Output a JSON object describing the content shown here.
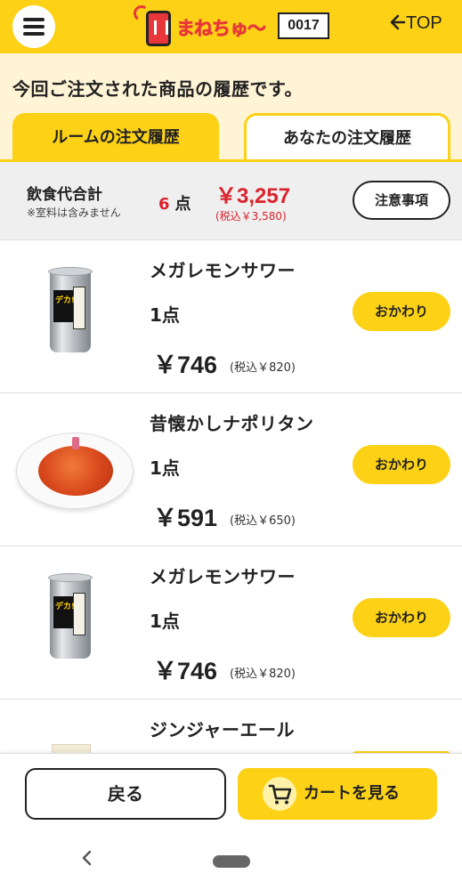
{
  "header": {
    "logo_text": "まねちゅ〜",
    "table_number": "0017",
    "top_link": "TOP"
  },
  "intro": "今回ご注文された商品の履歴です。",
  "tabs": [
    {
      "label": "ルームの注文履歴",
      "active": true
    },
    {
      "label": "あなたの注文履歴",
      "active": false
    }
  ],
  "summary": {
    "label": "飲食代合計",
    "note": "※室料は含みません",
    "count_number": "6",
    "count_unit": "点",
    "total": "￥3,257",
    "tax_included": "(税込￥3,580)",
    "notice_button": "注意事項"
  },
  "orders": [
    {
      "name": "メガレモンサワー",
      "qty": "1点",
      "price": "￥746",
      "tax": "(税込￥820)",
      "button": "おかわり",
      "image": "lemon-sour-can"
    },
    {
      "name": "昔懐かしナポリタン",
      "qty": "1点",
      "price": "￥591",
      "tax": "(税込￥650)",
      "button": "おかわり",
      "image": "napolitan-plate"
    },
    {
      "name": "メガレモンサワー",
      "qty": "1点",
      "price": "￥746",
      "tax": "(税込￥820)",
      "button": "おかわり",
      "image": "lemon-sour-can"
    },
    {
      "name": "ジンジャーエール",
      "image": "ginger-ale-glass"
    }
  ],
  "can_logo": "デカ!",
  "footer": {
    "back_button": "戻る",
    "cart_button": "カートを見る"
  },
  "colors": {
    "brand_yellow": "#fcd116",
    "price_red": "#d9232d",
    "cream": "#fff4d6"
  }
}
